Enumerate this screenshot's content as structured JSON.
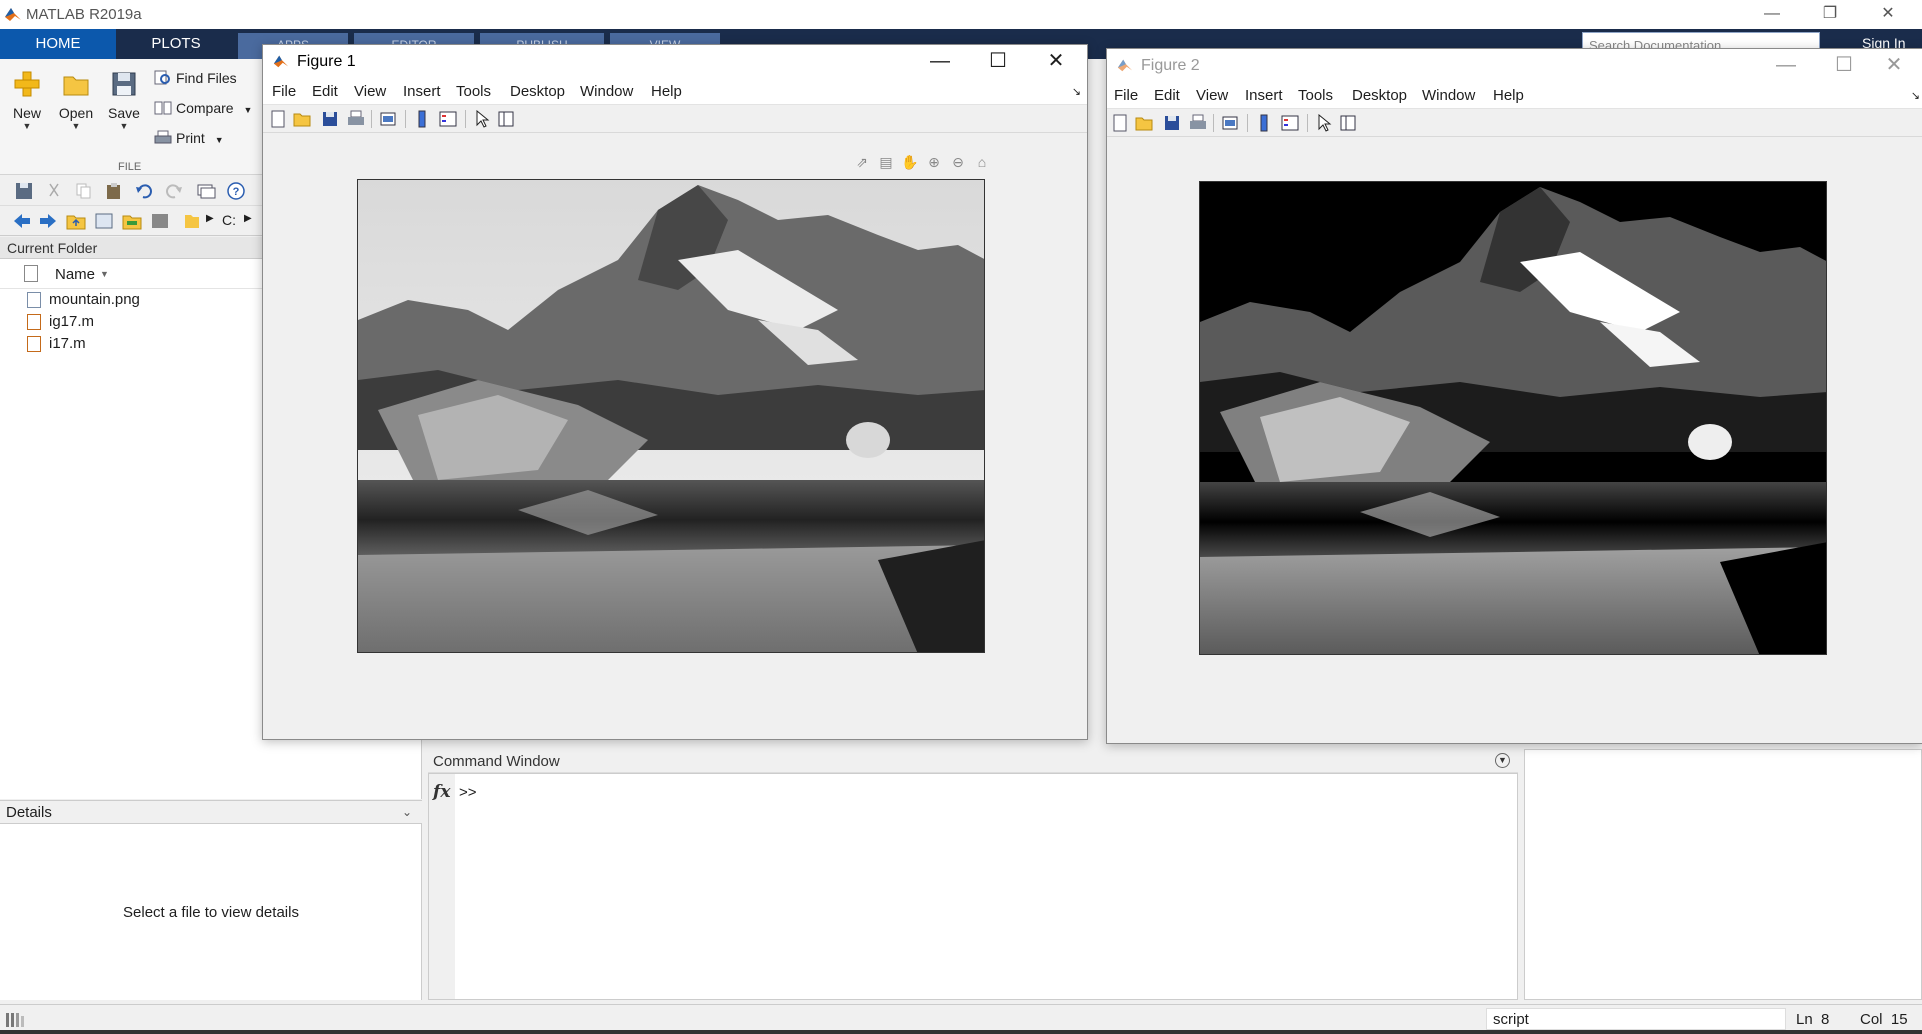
{
  "app": {
    "title": "MATLAB R2019a",
    "window_controls": [
      "—",
      "❐",
      "✕"
    ]
  },
  "ribbon": {
    "tabs": [
      "HOME",
      "PLOTS",
      "APPS",
      "EDITOR",
      "PUBLISH",
      "VIEW"
    ],
    "search_placeholder": "Search Documentation",
    "signin": "Sign In",
    "file_section": {
      "label": "FILE",
      "new": "New",
      "open": "Open",
      "save": "Save",
      "find_files": "Find Files",
      "compare": "Compare",
      "print": "Print"
    }
  },
  "address": {
    "path": "C:"
  },
  "current_folder": {
    "title": "Current Folder",
    "column_name": "Name",
    "files": [
      "mountain.png",
      "ig17.m",
      "i17.m"
    ]
  },
  "details": {
    "title": "Details",
    "message": "Select a file to view details"
  },
  "command_window": {
    "title": "Command Window",
    "fx": "fx",
    "prompt": ">>"
  },
  "status": {
    "mode": "script",
    "line_label": "Ln",
    "line": "8",
    "col_label": "Col",
    "col": "15"
  },
  "figures": [
    {
      "title": "Figure 1",
      "menus": [
        "File",
        "Edit",
        "View",
        "Insert",
        "Tools",
        "Desktop",
        "Window",
        "Help"
      ],
      "window_controls": [
        "—",
        "☐",
        "✕"
      ],
      "image": "original grayscale mountain lake photo"
    },
    {
      "title": "Figure 2",
      "menus": [
        "File",
        "Edit",
        "View",
        "Insert",
        "Tools",
        "Desktop",
        "Window",
        "Help"
      ],
      "window_controls": [
        "—",
        "☐",
        "✕"
      ],
      "image": "high-contrast mountain lake photo with black sky"
    }
  ],
  "colors": {
    "ribbon_dark": "#1a2c4b",
    "ribbon_active_tab": "#0c58ac",
    "matlab_orange": "#e3701a"
  }
}
